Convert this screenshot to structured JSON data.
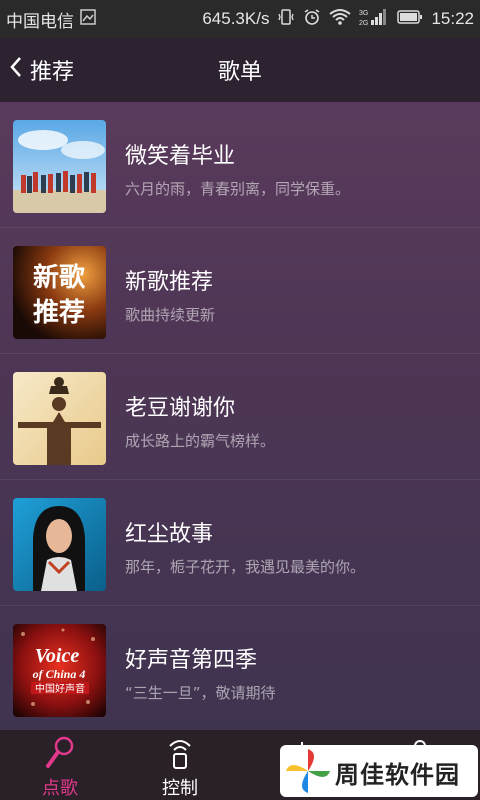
{
  "status_bar": {
    "carrier": "中国电信",
    "speed": "645.3K/s",
    "network": "3G 2G",
    "time": "15:22"
  },
  "header": {
    "back_label": "推荐",
    "title": "歌单"
  },
  "playlists": [
    {
      "name": "微笑着毕业",
      "desc": "六月的雨，青春别离，同学保重。",
      "cover_icon": "graduation-photo"
    },
    {
      "name": "新歌推荐",
      "desc": "歌曲持续更新",
      "cover_icon": "new-songs-cover",
      "cover_text": [
        "新歌",
        "推荐"
      ]
    },
    {
      "name": "老豆谢谢你",
      "desc": "成长路上的霸气榜样。",
      "cover_icon": "father-child-photo"
    },
    {
      "name": "红尘故事",
      "desc": "那年，栀子花开，我遇见最美的你。",
      "cover_icon": "singer-portrait"
    },
    {
      "name": "好声音第四季",
      "desc": "“三生一旦”，敬请期待",
      "cover_icon": "voice-of-china-logo",
      "cover_text": [
        "Voice",
        "of China 4",
        "中国好声音"
      ]
    }
  ],
  "tabs": [
    {
      "label": "点歌",
      "icon": "microphone-icon",
      "active": true
    },
    {
      "label": "控制",
      "icon": "remote-icon",
      "active": false
    },
    {
      "label": "",
      "icon": "tab3-icon",
      "active": false
    },
    {
      "label": "",
      "icon": "tab4-icon",
      "active": false
    }
  ],
  "watermark": {
    "text": "周佳软件园"
  },
  "colors": {
    "accent": "#e0388a",
    "header_bg": "#2d2230",
    "tab_bg": "#2a2028"
  }
}
